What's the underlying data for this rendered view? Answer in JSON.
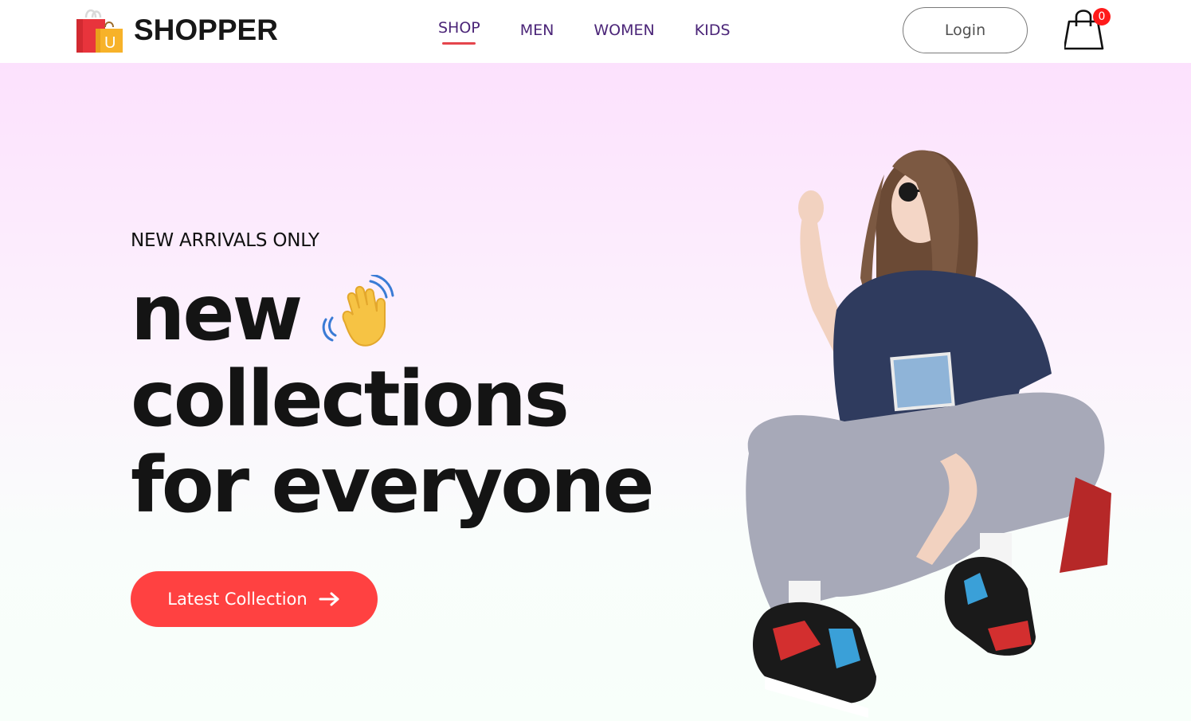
{
  "brand": {
    "name": "SHOPPER",
    "logo_letter": "U"
  },
  "nav": {
    "items": [
      {
        "label": "SHOP",
        "active": true
      },
      {
        "label": "MEN",
        "active": false
      },
      {
        "label": "WOMEN",
        "active": false
      },
      {
        "label": "KIDS",
        "active": false
      }
    ]
  },
  "header": {
    "login_label": "Login",
    "cart_count": "0",
    "cart_icon": "shopping-bag-icon"
  },
  "hero": {
    "kicker": "NEW ARRIVALS ONLY",
    "title_line1": "new",
    "title_line2": "collections",
    "title_line3": "for everyone",
    "wave_icon": "waving-hand-icon",
    "cta_label": "Latest Collection",
    "cta_icon": "arrow-right-icon"
  },
  "colors": {
    "accent": "#ff4141",
    "nav_text": "#4b2578",
    "badge": "#ff1a1a"
  }
}
